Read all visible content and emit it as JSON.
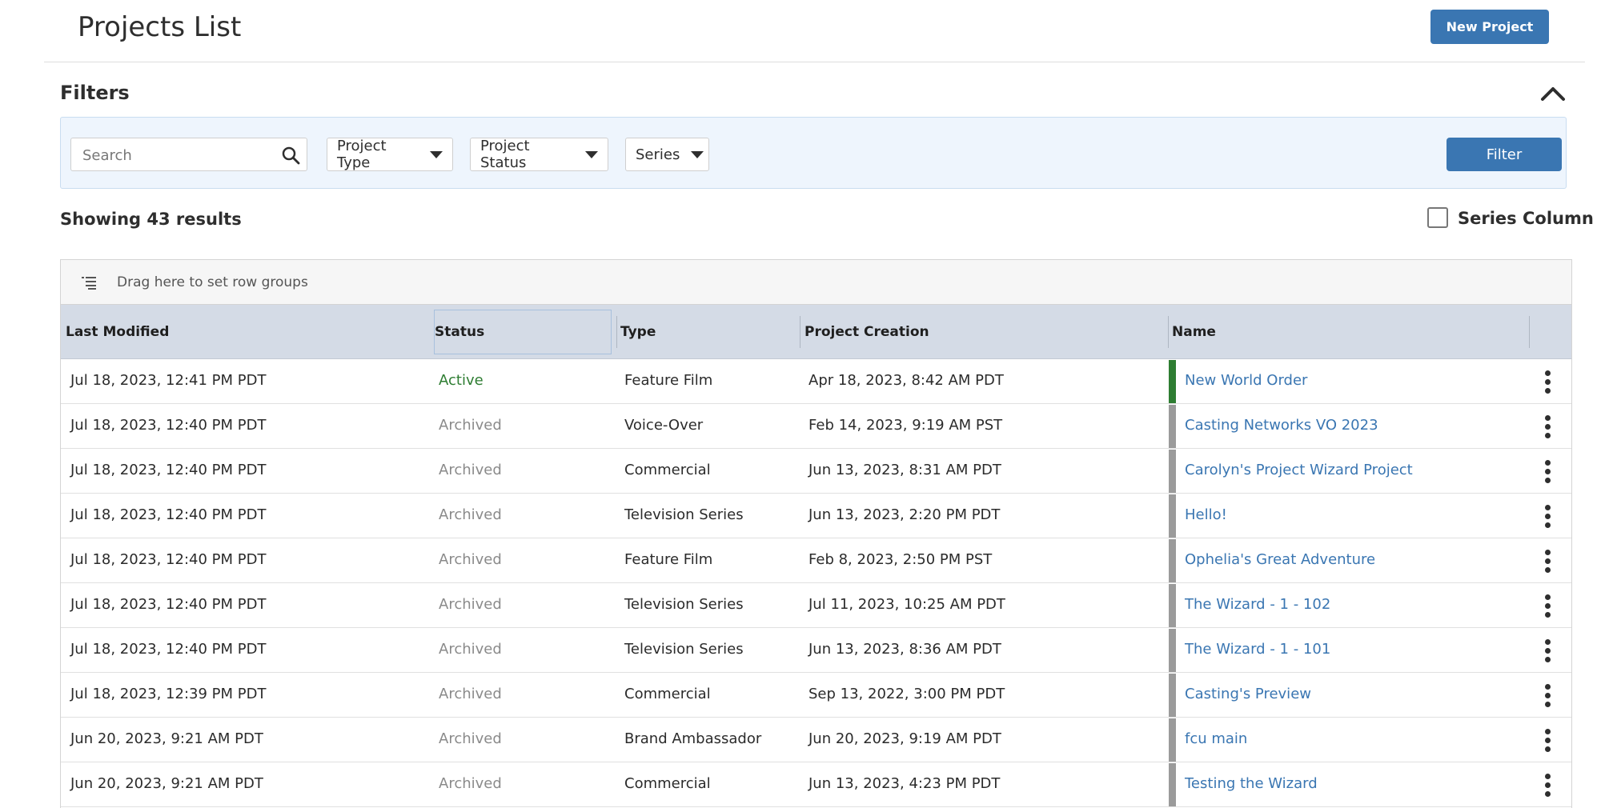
{
  "header": {
    "title": "Projects List",
    "new_project_label": "New Project"
  },
  "filters": {
    "title": "Filters",
    "search_placeholder": "Search",
    "dropdowns": [
      {
        "label": "Project Type"
      },
      {
        "label": "Project Status"
      },
      {
        "label": "Series"
      }
    ],
    "filter_button_label": "Filter"
  },
  "results": {
    "summary": "Showing 43 results",
    "series_column_label": "Series Column",
    "series_column_checked": false
  },
  "grid": {
    "group_hint": "Drag here to set row groups",
    "columns": [
      "Last Modified",
      "Status",
      "Type",
      "Project Creation",
      "Name"
    ],
    "rows": [
      {
        "last_modified": "Jul 18, 2023, 12:41 PM PDT",
        "status": "Active",
        "type": "Feature Film",
        "created": "Apr 18, 2023, 8:42 AM PDT",
        "name": "New World Order"
      },
      {
        "last_modified": "Jul 18, 2023, 12:40 PM PDT",
        "status": "Archived",
        "type": "Voice-Over",
        "created": "Feb 14, 2023, 9:19 AM PST",
        "name": "Casting Networks VO 2023"
      },
      {
        "last_modified": "Jul 18, 2023, 12:40 PM PDT",
        "status": "Archived",
        "type": "Commercial",
        "created": "Jun 13, 2023, 8:31 AM PDT",
        "name": "Carolyn's Project Wizard Project"
      },
      {
        "last_modified": "Jul 18, 2023, 12:40 PM PDT",
        "status": "Archived",
        "type": "Television Series",
        "created": "Jun 13, 2023, 2:20 PM PDT",
        "name": "Hello!"
      },
      {
        "last_modified": "Jul 18, 2023, 12:40 PM PDT",
        "status": "Archived",
        "type": "Feature Film",
        "created": "Feb 8, 2023, 2:50 PM PST",
        "name": "Ophelia's Great Adventure"
      },
      {
        "last_modified": "Jul 18, 2023, 12:40 PM PDT",
        "status": "Archived",
        "type": "Television Series",
        "created": "Jul 11, 2023, 10:25 AM PDT",
        "name": "The Wizard - 1 - 102"
      },
      {
        "last_modified": "Jul 18, 2023, 12:40 PM PDT",
        "status": "Archived",
        "type": "Television Series",
        "created": "Jun 13, 2023, 8:36 AM PDT",
        "name": "The Wizard - 1 - 101"
      },
      {
        "last_modified": "Jul 18, 2023, 12:39 PM PDT",
        "status": "Archived",
        "type": "Commercial",
        "created": "Sep 13, 2022, 3:00 PM PDT",
        "name": "Casting's Preview"
      },
      {
        "last_modified": "Jun 20, 2023, 9:21 AM PDT",
        "status": "Archived",
        "type": "Brand Ambassador",
        "created": "Jun 20, 2023, 9:19 AM PDT",
        "name": "fcu main"
      },
      {
        "last_modified": "Jun 20, 2023, 9:21 AM PDT",
        "status": "Archived",
        "type": "Commercial",
        "created": "Jun 13, 2023, 4:23 PM PDT",
        "name": "Testing the Wizard"
      }
    ]
  },
  "colors": {
    "accent": "#3a76b2",
    "active_status": "#2e7d32",
    "active_bar": "#2e7d32",
    "archived_bar": "#9b9b9b",
    "header_bg": "#d4dbe6",
    "filter_panel_bg": "#eef5fd"
  }
}
